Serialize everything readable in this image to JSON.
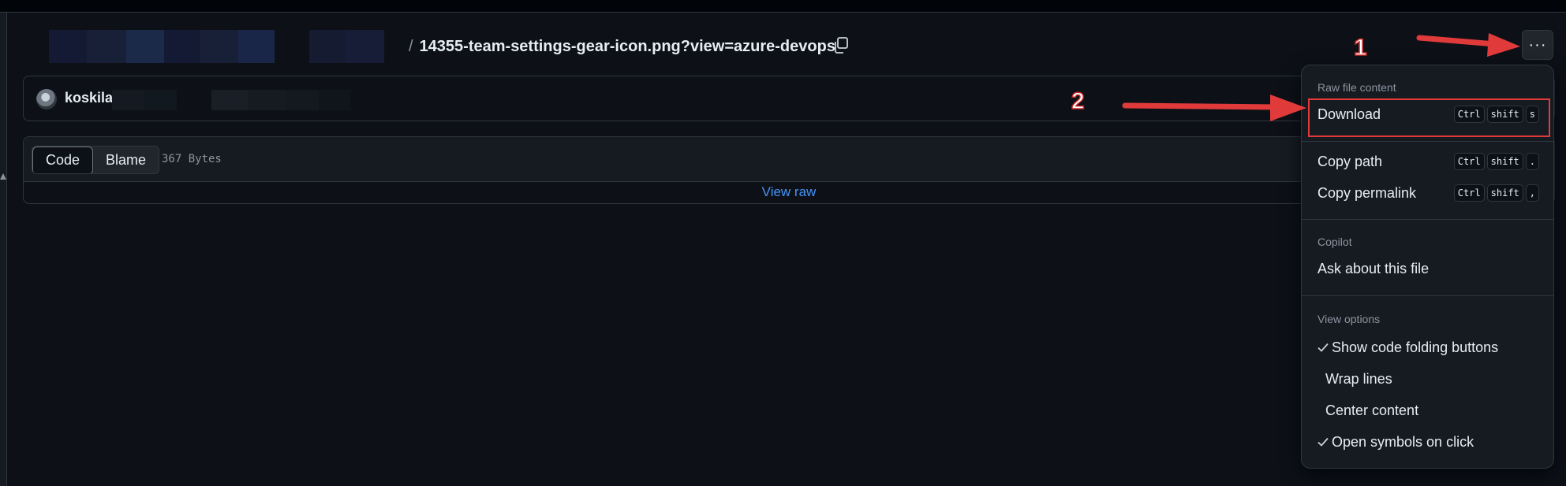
{
  "breadcrumb": {
    "separator": "/",
    "file_name": "14355-team-settings-gear-icon.png?view=azure-devops"
  },
  "commit": {
    "author": "koskila"
  },
  "file_header": {
    "tabs": [
      {
        "label": "Code",
        "active": true
      },
      {
        "label": "Blame",
        "active": false
      }
    ],
    "size": "367 Bytes",
    "view_raw": "View raw"
  },
  "more_button": {
    "label": "···"
  },
  "menu": {
    "raw_title": "Raw file content",
    "download": {
      "label": "Download",
      "keys": [
        "Ctrl",
        "shift",
        "s"
      ]
    },
    "copy_path": {
      "label": "Copy path",
      "keys": [
        "Ctrl",
        "shift",
        "."
      ]
    },
    "copy_permalink": {
      "label": "Copy permalink",
      "keys": [
        "Ctrl",
        "shift",
        ","
      ]
    },
    "copilot_title": "Copilot",
    "ask": {
      "label": "Ask about this file"
    },
    "view_title": "View options",
    "view_options": [
      {
        "label": "Show code folding buttons",
        "checked": true
      },
      {
        "label": "Wrap lines",
        "checked": false
      },
      {
        "label": "Center content",
        "checked": false
      },
      {
        "label": "Open symbols on click",
        "checked": true
      }
    ]
  },
  "annotations": {
    "step1": "1",
    "step2": "2",
    "color": "#e03a3a"
  },
  "colors": {
    "background": "#0d1117",
    "surface": "#161b22",
    "border": "#30363d",
    "link": "#4493f8",
    "muted": "#8b949e"
  }
}
